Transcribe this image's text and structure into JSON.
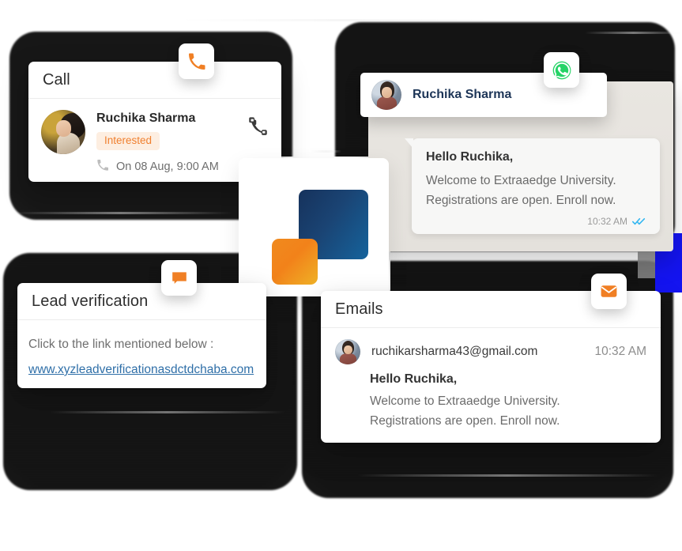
{
  "theme": {
    "accent_orange": "#f07f24",
    "accent_blue": "#1d3557",
    "whatsapp_green": "#25d366",
    "link_blue": "#2f6fa8",
    "tag_bg": "#fdeee1",
    "tag_text": "#f08030"
  },
  "logo": {
    "name": "extraaedge-logo",
    "blue": "#16325c",
    "orange": "#f0851e"
  },
  "call_card": {
    "title": "Call",
    "badge_icon": "phone-icon",
    "contact_name": "Ruchika Sharma",
    "status_tag": "Interested",
    "schedule": "On 08 Aug, 9:00 AM",
    "schedule_icon": "phone-outgoing-icon",
    "action_icon": "phone-call-icon",
    "avatar": "ruchika-avatar"
  },
  "whatsapp_card": {
    "badge_icon": "whatsapp-icon",
    "contact_name": "Ruchika Sharma",
    "avatar": "ruchika-avatar",
    "message": {
      "greeting": "Hello Ruchika,",
      "line1": "Welcome to Extraaedge University.",
      "line2": "Registrations are  open. Enroll now.",
      "time": "10:32 AM",
      "read_receipt": "double-check-icon"
    }
  },
  "lead_card": {
    "title": "Lead verification",
    "badge_icon": "chat-bubble-icon",
    "prompt": "Click to the link mentioned below :",
    "link": "www.xyzleadverificationasdctdchaba.com"
  },
  "email_card": {
    "title": "Emails",
    "badge_icon": "envelope-icon",
    "sender": "ruchikarsharma43@gmail.com",
    "time": "10:32 AM",
    "avatar": "ruchika-avatar",
    "message": {
      "greeting": "Hello Ruchika,",
      "line1": "Welcome to Extraaedge University.",
      "line2": "Registrations are  open. Enroll now."
    }
  }
}
